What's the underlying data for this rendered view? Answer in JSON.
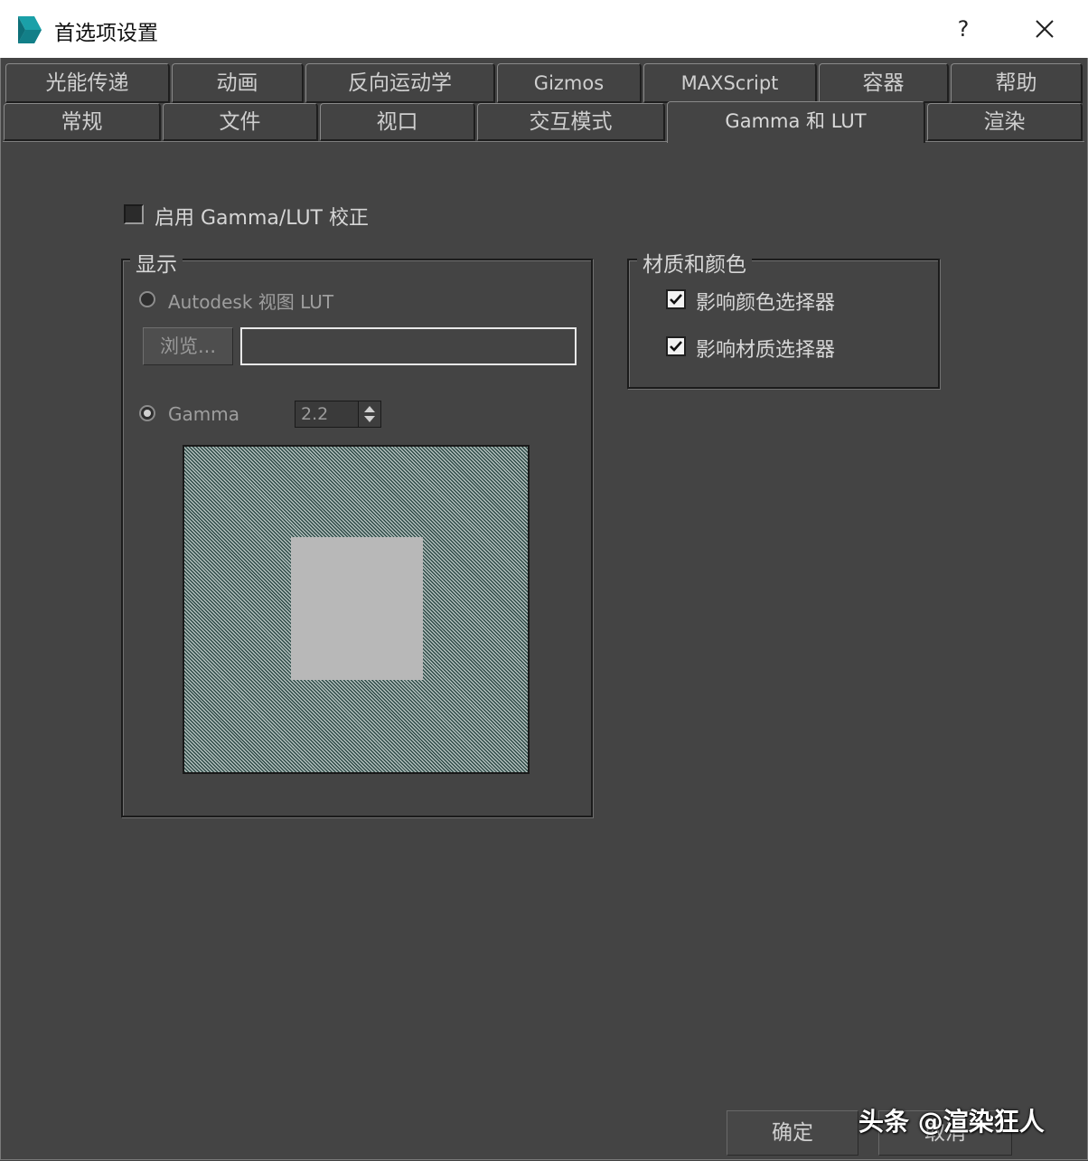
{
  "window": {
    "title": "首选项设置",
    "help_label": "?"
  },
  "tabs_row1": [
    {
      "label": "光能传递"
    },
    {
      "label": "动画"
    },
    {
      "label": "反向运动学"
    },
    {
      "label": "Gizmos"
    },
    {
      "label": "MAXScript"
    },
    {
      "label": "容器"
    },
    {
      "label": "帮助"
    }
  ],
  "tabs_row2": [
    {
      "label": "常规"
    },
    {
      "label": "文件"
    },
    {
      "label": "视口"
    },
    {
      "label": "交互模式"
    },
    {
      "label": "Gamma 和 LUT",
      "active": true
    },
    {
      "label": "渲染"
    }
  ],
  "enable_gamma": {
    "label": "启用 Gamma/LUT 校正",
    "checked": false
  },
  "display_group": {
    "title": "显示",
    "autodesk_lut": {
      "label": "Autodesk 视图 LUT",
      "selected": false
    },
    "browse_label": "浏览...",
    "lut_path_value": "",
    "gamma": {
      "label": "Gamma",
      "selected": true,
      "value": "2.2"
    }
  },
  "material_group": {
    "title": "材质和颜色",
    "affect_color_picker": {
      "label": "影响颜色选择器",
      "checked": true
    },
    "affect_material_picker": {
      "label": "影响材质选择器",
      "checked": true
    }
  },
  "footer": {
    "ok_label": "确定",
    "cancel_label": "取消"
  },
  "watermark": "头条 @渲染狂人",
  "colors": {
    "dialog_bg": "#444444",
    "titlebar_bg": "#ffffff",
    "icon_accent": "#1aa0a8"
  }
}
